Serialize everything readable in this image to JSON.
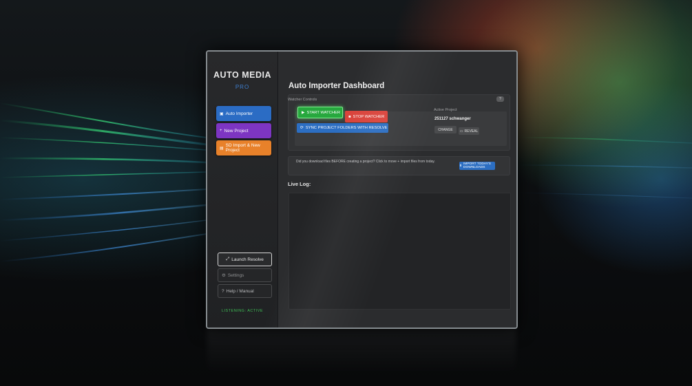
{
  "sidebar": {
    "brand_title": "AUTO MEDIA",
    "brand_sub": "PRO",
    "nav": [
      {
        "label": "Auto Importer",
        "icon": "folder-icon",
        "color": "#2b6cc4"
      },
      {
        "label": "New Project",
        "icon": "plus-icon",
        "color": "#7d35c2"
      },
      {
        "label": "SD Import & New Project",
        "icon": "sd-card-icon",
        "color": "#e8812a"
      }
    ],
    "launch_label": "Launch Resolve",
    "settings_label": "Settings",
    "help_label": "Help / Manual",
    "status": "LISTENING: ACTIVE"
  },
  "main": {
    "title": "Auto Importer Dashboard",
    "help_badge": "?",
    "watcher_label": "Watcher Controls",
    "start_label": "START WATCHER",
    "stop_label": "STOP WATCHER",
    "sync_label": "SYNC PROJECT FOLDERS WITH RESOLVE",
    "active_label": "Active Project",
    "active_value": "251127 schwanger",
    "change_label": "CHANGE",
    "reveal_label": "REVEAL",
    "banner_text": "Did you download files BEFORE creating a project? Click to move + import files from today.",
    "import_label": "IMPORT TODAY'S DOWNLOADS",
    "log_label": "Live Log:"
  },
  "colors": {
    "accent_blue": "#2c6ec2",
    "accent_green": "#27a83e",
    "accent_red": "#d9423a",
    "accent_purple": "#7d35c2",
    "accent_orange": "#e8812a"
  }
}
